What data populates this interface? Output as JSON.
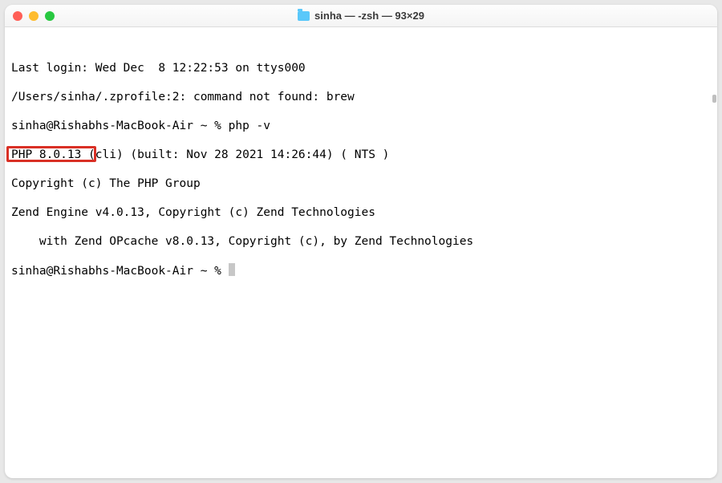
{
  "titlebar": {
    "title": "sinha — -zsh — 93×29"
  },
  "terminal": {
    "lines": {
      "l0": "Last login: Wed Dec  8 12:22:53 on ttys000",
      "l1": "/Users/sinha/.zprofile:2: command not found: brew",
      "l2_prompt": "sinha@Rishabhs-MacBook-Air ~ % ",
      "l2_cmd": "php -v",
      "l3_highlight": "PHP 8.0.13 ",
      "l3_rest": "(cli) (built: Nov 28 2021 14:26:44) ( NTS )",
      "l4": "Copyright (c) The PHP Group",
      "l5": "Zend Engine v4.0.13, Copyright (c) Zend Technologies",
      "l6": "    with Zend OPcache v8.0.13, Copyright (c), by Zend Technologies",
      "l7_prompt": "sinha@Rishabhs-MacBook-Air ~ % "
    }
  },
  "annotation": {
    "highlight_box_color": "#d93025"
  }
}
